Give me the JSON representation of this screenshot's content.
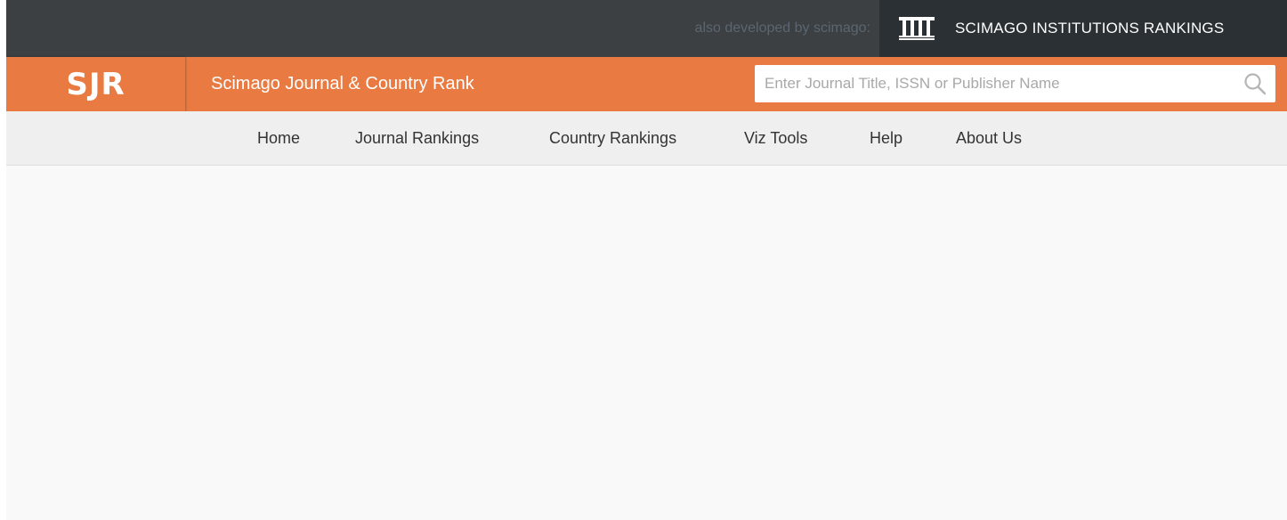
{
  "topbar": {
    "also_developed_text": "also developed by scimago:",
    "sir_link": {
      "label": "SCIMAGO INSTITUTIONS RANKINGS",
      "icon": "institution-columns-icon"
    }
  },
  "header": {
    "logo": "SJR",
    "site_title": "Scimago Journal & Country Rank",
    "search": {
      "placeholder": "Enter Journal Title, ISSN or Publisher Name",
      "value": "",
      "icon": "search-icon"
    }
  },
  "nav": {
    "items": [
      {
        "label": "Home"
      },
      {
        "label": "Journal Rankings"
      },
      {
        "label": "Country Rankings"
      },
      {
        "label": "Viz Tools"
      },
      {
        "label": "Help"
      },
      {
        "label": "About Us"
      }
    ]
  },
  "colors": {
    "topbar_bg": "#3c4043",
    "sir_bg": "#2b3035",
    "accent_orange": "#e97b42",
    "nav_bg": "#efefef",
    "page_bg": "#f9f9f9"
  }
}
